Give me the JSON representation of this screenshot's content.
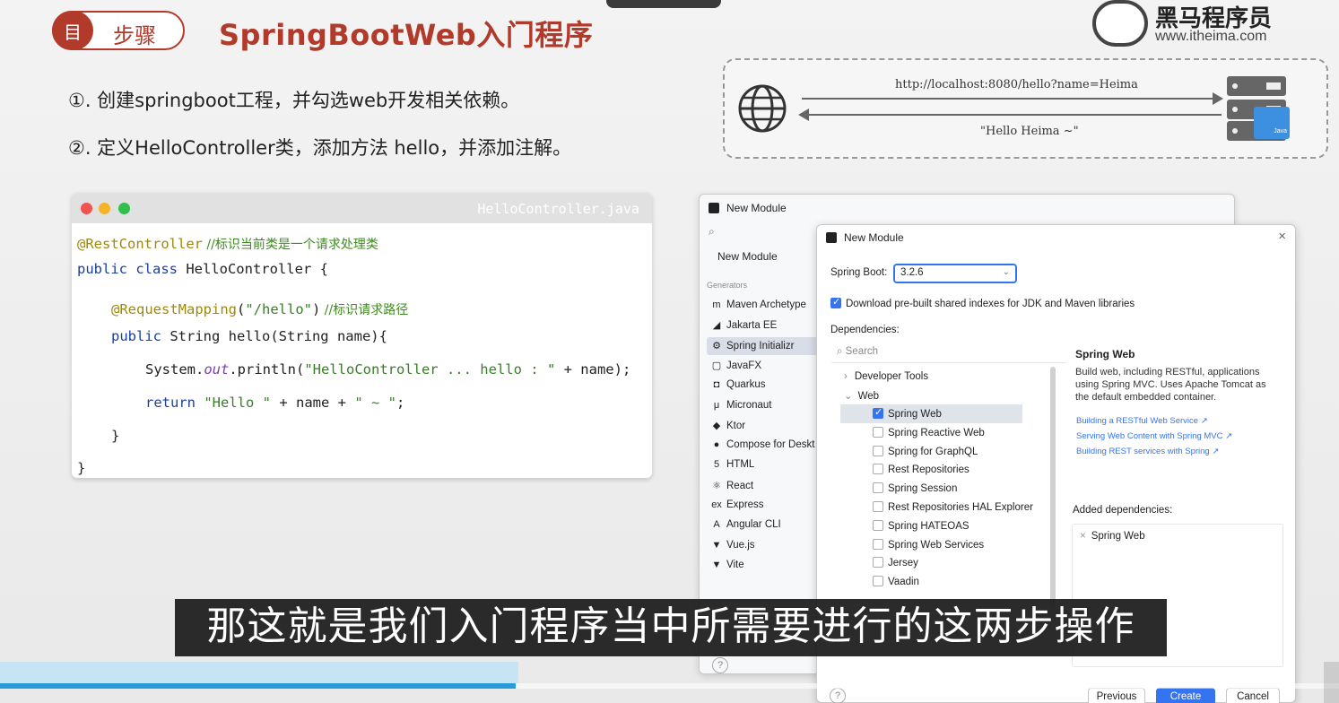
{
  "header": {
    "step_icon": "目",
    "step_label": "步骤",
    "title": "SpringBootWeb入门程序",
    "logo_name": "黑马程序员",
    "logo_url": "www.itheima.com"
  },
  "steps": [
    "①. 创建springboot工程，并勾选web开发相关依赖。",
    "②. 定义HelloController类，添加方法 hello，并添加注解。"
  ],
  "http_diagram": {
    "request_url": "http://localhost:8080/hello?name=Heima",
    "response": "\"Hello Heima ~\"",
    "folder_label": "Java"
  },
  "code_panel": {
    "filename": "HelloController.java",
    "lines": {
      "l1_ann": "@RestController",
      "l1_cmt": " //标识当前类是一个请求处理类",
      "l2_kw": "public class",
      "l2_rest": " HelloController {",
      "l3_ann": "@RequestMapping",
      "l3_paren1": "(",
      "l3_str": "\"/hello\"",
      "l3_paren2": ")",
      "l3_cmt": " //标识请求路径",
      "l4_kw": "public",
      "l4_rest": " String hello(String name){",
      "l5_a": "System.",
      "l5_it": "out",
      "l5_b": ".println(",
      "l5_str": "\"HelloController ... hello : \"",
      "l5_c": " + name);",
      "l6_kw": "return",
      "l6_sp": " ",
      "l6_str1": "\"Hello \"",
      "l6_mid": " + name + ",
      "l6_str2": "\" ~ \"",
      "l6_end": ";",
      "l7": "}",
      "l8": "}"
    }
  },
  "back_window": {
    "title": "New Module",
    "search_icon": "search-icon",
    "new_module": "New Module",
    "generators_label": "Generators",
    "generators": [
      {
        "icon": "m",
        "label": "Maven Archetype"
      },
      {
        "icon": "◢",
        "label": "Jakarta EE"
      },
      {
        "icon": "⚙",
        "label": "Spring Initializr"
      },
      {
        "icon": "▢",
        "label": "JavaFX"
      },
      {
        "icon": "◘",
        "label": "Quarkus"
      },
      {
        "icon": "μ",
        "label": "Micronaut"
      },
      {
        "icon": "◆",
        "label": "Ktor"
      },
      {
        "icon": "●",
        "label": "Compose for Deskt"
      },
      {
        "icon": "5",
        "label": "HTML"
      },
      {
        "icon": "⚛",
        "label": "React"
      },
      {
        "icon": "ex",
        "label": "Express"
      },
      {
        "icon": "A",
        "label": "Angular CLI"
      },
      {
        "icon": "▼",
        "label": "Vue.js"
      },
      {
        "icon": "▼",
        "label": "Vite"
      }
    ],
    "help": "?"
  },
  "front_window": {
    "title": "New Module",
    "close": "×",
    "spring_boot_label": "Spring Boot:",
    "spring_boot_value": "3.2.6",
    "download_label": "Download pre-built shared indexes for JDK and Maven libraries",
    "dependencies_label": "Dependencies:",
    "search_placeholder": "Search",
    "tree": {
      "developer_tools": "Developer Tools",
      "web": "Web",
      "items": [
        {
          "label": "Spring Web",
          "checked": true
        },
        {
          "label": "Spring Reactive Web",
          "checked": false
        },
        {
          "label": "Spring for GraphQL",
          "checked": false
        },
        {
          "label": "Rest Repositories",
          "checked": false
        },
        {
          "label": "Spring Session",
          "checked": false
        },
        {
          "label": "Rest Repositories HAL Explorer",
          "checked": false
        },
        {
          "label": "Spring HATEOAS",
          "checked": false
        },
        {
          "label": "Spring Web Services",
          "checked": false
        },
        {
          "label": "Jersey",
          "checked": false
        },
        {
          "label": "Vaadin",
          "checked": false
        }
      ]
    },
    "description": {
      "title": "Spring Web",
      "text": "Build web, including RESTful, applications using Spring MVC. Uses Apache Tomcat as the default embedded container.",
      "links": [
        "Building a RESTful Web Service ↗",
        "Serving Web Content with Spring MVC ↗",
        "Building REST services with Spring ↗"
      ]
    },
    "added_label": "Added dependencies:",
    "added_items": [
      "Spring Web"
    ],
    "help": "?",
    "buttons": {
      "previous": "Previous",
      "create": "Create",
      "cancel": "Cancel"
    }
  },
  "subtitle": "那这就是我们入门程序当中所需要进行的这两步操作",
  "video": {
    "progress": 0.385
  }
}
